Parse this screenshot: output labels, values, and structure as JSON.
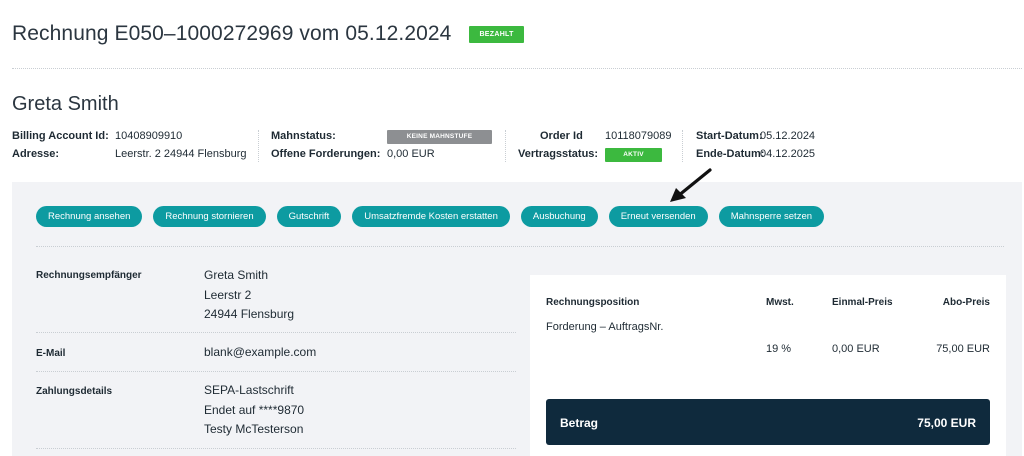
{
  "header": {
    "title": "Rechnung E050–1000272969 vom 05.12.2024",
    "status_badge": "BEZAHLT",
    "status_color": "#3cb93f"
  },
  "customer": {
    "name": "Greta Smith"
  },
  "account_info": {
    "billing_account_id_label": "Billing Account Id:",
    "billing_account_id": "10408909910",
    "address_label": "Adresse:",
    "address": "Leerstr. 2 24944 Flensburg",
    "mahnstatus_label": "Mahnstatus:",
    "mahnstatus": "KEINE MAHNSTUFE",
    "offene_label": "Offene Forderungen:",
    "offene": "0,00 EUR",
    "order_id_label": "Order Id",
    "order_id": "10118079089",
    "vertragsstatus_label": "Vertragsstatus:",
    "vertragsstatus": "AKTIV",
    "start_label": "Start-Datum:",
    "start": "05.12.2024",
    "ende_label": "Ende-Datum:",
    "ende": "04.12.2025"
  },
  "actions": [
    "Rechnung ansehen",
    "Rechnung stornieren",
    "Gutschrift",
    "Umsatzfremde Kosten erstatten",
    "Ausbuchung",
    "Erneut versenden",
    "Mahnsperre setzen"
  ],
  "details": {
    "recipient_label": "Rechnungsempfänger",
    "recipient_line1": "Greta Smith",
    "recipient_line2": "Leerstr 2",
    "recipient_line3": "24944 Flensburg",
    "email_label": "E-Mail",
    "email": "blank@example.com",
    "payment_label": "Zahlungsdetails",
    "payment_line1": "SEPA-Lastschrift",
    "payment_line2": "Endet auf ****9870",
    "payment_line3": "Testy McTesterson"
  },
  "invoice_table": {
    "headers": [
      "Rechnungsposition",
      "Mwst.",
      "Einmal-Preis",
      "Abo-Preis"
    ],
    "row": {
      "position": "Forderung – AuftragsNr.",
      "mwst": "19 %",
      "einmal": "0,00 EUR",
      "abo": "75,00 EUR"
    },
    "total_label": "Betrag",
    "total_value": "75,00 EUR"
  },
  "colors": {
    "accent": "#0d9ba1",
    "total_bar": "#0f2a3d",
    "panel_bg": "#f2f3f6"
  }
}
